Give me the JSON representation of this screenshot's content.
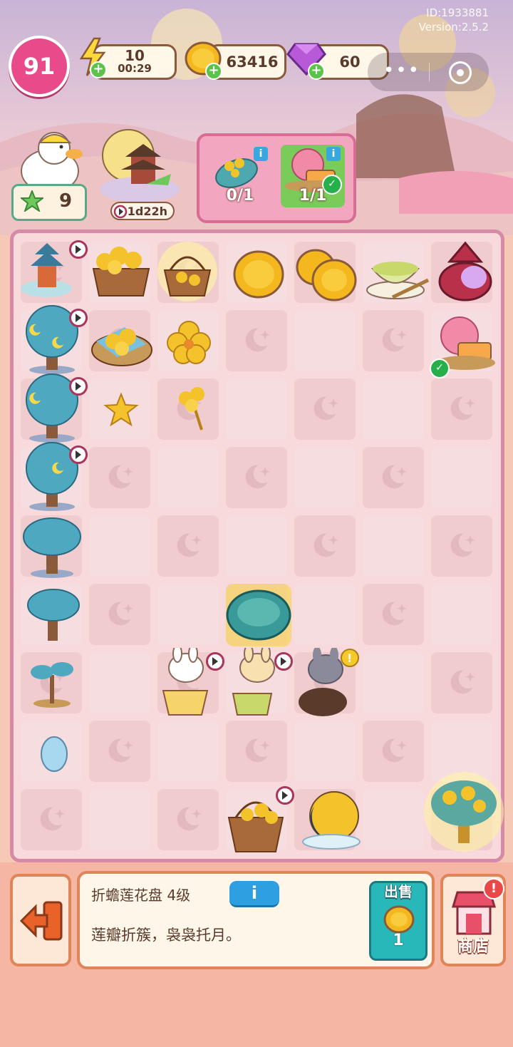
{
  "header": {
    "user_id": "ID:1933881",
    "version": "Version:2.5.2"
  },
  "hud": {
    "level": "91",
    "energy": {
      "value": "10",
      "timer": "00:29"
    },
    "coins": "63416",
    "gems": "60"
  },
  "character": {
    "star_level": "9",
    "event_timer": "1d22h"
  },
  "orders": [
    {
      "count": "0/1",
      "done": false
    },
    {
      "count": "1/1",
      "done": true
    }
  ],
  "board": {
    "columns": 7,
    "rows": 9
  },
  "selected_item": {
    "name": "折蟾莲花盘 4级",
    "description": "莲瓣折簇，袅袅托月。",
    "info_label": "i",
    "sell_label": "出售",
    "sell_price": "1"
  },
  "shop": {
    "label": "商店",
    "alert": "!"
  },
  "colors": {
    "board_border": "#d78aa8",
    "panel_border": "#e0855a",
    "sell_teal": "#29b8b9",
    "info_blue": "#2e9fe0"
  }
}
